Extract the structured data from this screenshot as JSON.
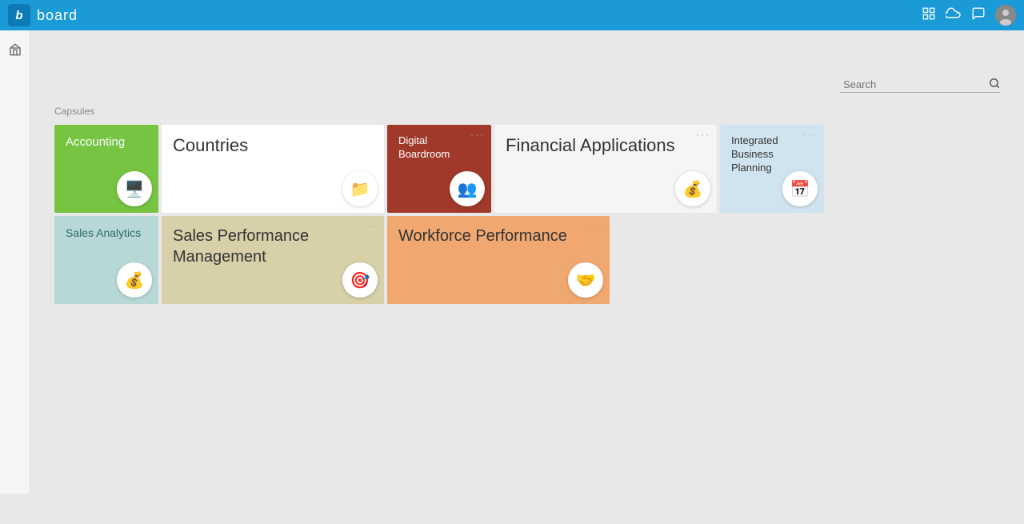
{
  "app": {
    "logo_letter": "b",
    "logo_text": "board"
  },
  "topbar": {
    "icons": [
      "notifications-icon",
      "cloud-icon",
      "chat-icon",
      "avatar-icon"
    ]
  },
  "sidebar": {
    "icons": [
      "inbox-icon"
    ]
  },
  "search": {
    "placeholder": "Search"
  },
  "capsules_label": "Capsules",
  "capsules_row1": [
    {
      "id": "accounting",
      "title": "Accounting",
      "color": "green",
      "icon": "🖥️",
      "has_menu": false
    },
    {
      "id": "countries",
      "title": "Countries",
      "color": "white",
      "icon": "📁",
      "has_menu": false
    },
    {
      "id": "digital-boardroom",
      "title": "Digital Boardroom",
      "color": "darkred",
      "icon": "👥",
      "has_menu": true
    },
    {
      "id": "financial-applications",
      "title": "Financial Applications",
      "color": "lightgray",
      "icon": "💰",
      "has_menu": true
    },
    {
      "id": "integrated-business-planning",
      "title": "Integrated Business Planning",
      "color": "ibp",
      "icon": "📅",
      "has_menu": true
    }
  ],
  "capsules_row2": [
    {
      "id": "sales-analytics",
      "title": "Sales Analytics",
      "color": "teal",
      "icon": "💰",
      "has_menu": false
    },
    {
      "id": "sales-performance-management",
      "title": "Sales Performance Management",
      "color": "beige",
      "icon": "🎯",
      "has_menu": true
    },
    {
      "id": "workforce-performance",
      "title": "Workforce Performance",
      "color": "orange",
      "icon": "🤝",
      "has_menu": true
    }
  ]
}
